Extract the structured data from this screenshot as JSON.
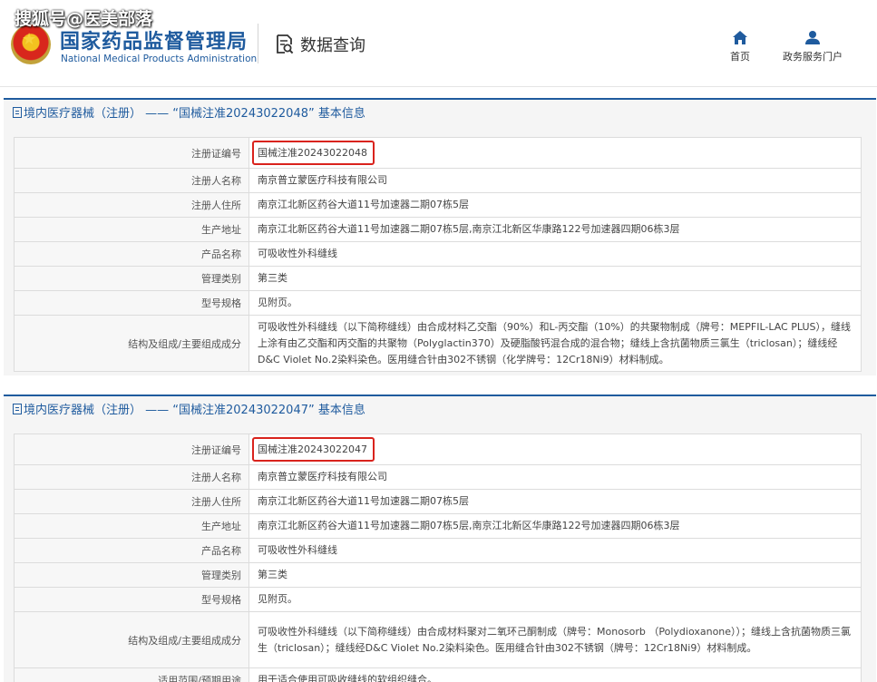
{
  "watermark": "搜狐号@医美部落",
  "header": {
    "brand_cn": "国家药品监督管理局",
    "brand_en": "National Medical Products Administration",
    "query_title": "数据查询",
    "nav": [
      {
        "label": "首页",
        "icon": "home-icon"
      },
      {
        "label": "政务服务门户",
        "icon": "user-icon"
      }
    ]
  },
  "sections": [
    {
      "title": "境内医疗器械（注册） —— “国械注准20243022048” 基本信息",
      "rows": [
        {
          "label": "注册证编号",
          "value": "国械注准20243022048",
          "highlight": true
        },
        {
          "label": "注册人名称",
          "value": "南京普立蒙医疗科技有限公司"
        },
        {
          "label": "注册人住所",
          "value": "南京江北新区药谷大道11号加速器二期07栋5层"
        },
        {
          "label": "生产地址",
          "value": "南京江北新区药谷大道11号加速器二期07栋5层,南京江北新区华康路122号加速器四期06栋3层"
        },
        {
          "label": "产品名称",
          "value": "可吸收性外科缝线"
        },
        {
          "label": "管理类别",
          "value": "第三类"
        },
        {
          "label": "型号规格",
          "value": "见附页。"
        },
        {
          "label": "结构及组成/主要组成成分",
          "value": "可吸收性外科缝线（以下简称缝线）由合成材料乙交酯（90%）和L-丙交酯（10%）的共聚物制成（牌号：MEPFIL-LAC PLUS），缝线上涂有由乙交酯和丙交酯的共聚物（Polyglactin370）及硬脂酸钙混合成的混合物；缝线上含抗菌物质三氯生（triclosan）；缝线经D&C Violet No.2染料染色。医用缝合针由302不锈钢（化学牌号：12Cr18Ni9）材料制成。"
        }
      ]
    },
    {
      "title": "境内医疗器械（注册） —— “国械注准20243022047” 基本信息",
      "rows": [
        {
          "label": "注册证编号",
          "value": "国械注准20243022047",
          "highlight": true
        },
        {
          "label": "注册人名称",
          "value": "南京普立蒙医疗科技有限公司"
        },
        {
          "label": "注册人住所",
          "value": "南京江北新区药谷大道11号加速器二期07栋5层"
        },
        {
          "label": "生产地址",
          "value": "南京江北新区药谷大道11号加速器二期07栋5层,南京江北新区华康路122号加速器四期06栋3层"
        },
        {
          "label": "产品名称",
          "value": "可吸收性外科缝线"
        },
        {
          "label": "管理类别",
          "value": "第三类"
        },
        {
          "label": "型号规格",
          "value": "见附页。"
        },
        {
          "label": "结构及组成/主要组成成分",
          "value": "可吸收性外科缝线（以下简称缝线）由合成材料聚对二氧环己酮制成（牌号：Monosorb （Polydioxanone））；缝线上含抗菌物质三氯生（triclosan）；缝线经D&C Violet No.2染料染色。医用缝合针由302不锈钢（牌号：12Cr18Ni9）材料制成。"
        },
        {
          "label": "适用范围/预期用途",
          "value": "用于适合使用可吸收缝线的软组织缝合。"
        }
      ]
    }
  ],
  "colors": {
    "brand": "#1f5b9e",
    "highlight": "#d9231d",
    "label_bg": "#f7f7f7",
    "section_bg": "#f5f5f5"
  }
}
